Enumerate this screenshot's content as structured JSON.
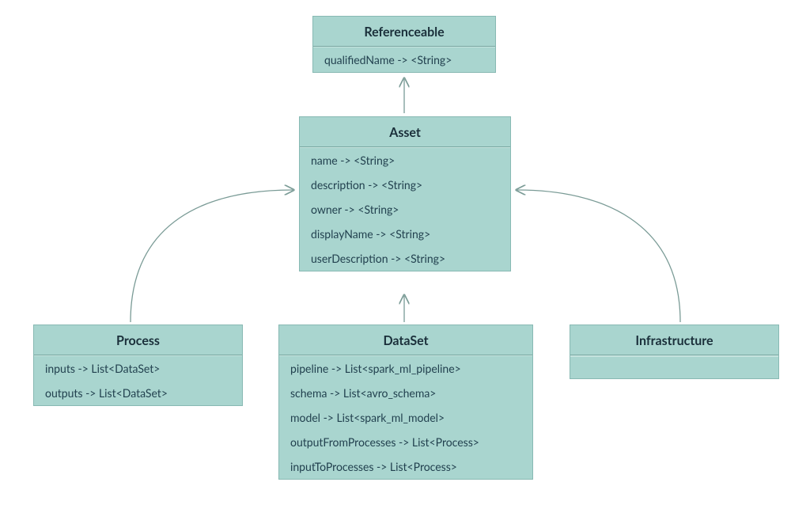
{
  "classes": {
    "referenceable": {
      "title": "Referenceable",
      "attrs": [
        "qualifiedName -> <String>"
      ]
    },
    "asset": {
      "title": "Asset",
      "attrs": [
        "name -> <String>",
        "description -> <String>",
        "owner -> <String>",
        "displayName -> <String>",
        "userDescription -> <String>"
      ]
    },
    "process": {
      "title": "Process",
      "attrs": [
        "inputs -> List<DataSet>",
        "outputs -> List<DataSet>"
      ]
    },
    "dataset": {
      "title": "DataSet",
      "attrs": [
        "pipeline -> List<spark_ml_pipeline>",
        "schema -> List<avro_schema>",
        "model -> List<spark_ml_model>",
        "outputFromProcesses -> List<Process>",
        "inputToProcesses -> List<Process>"
      ]
    },
    "infrastructure": {
      "title": "Infrastructure",
      "attrs": []
    }
  },
  "relationships": [
    {
      "from": "asset",
      "to": "referenceable",
      "type": "inherits"
    },
    {
      "from": "process",
      "to": "asset",
      "type": "inherits"
    },
    {
      "from": "dataset",
      "to": "asset",
      "type": "inherits"
    },
    {
      "from": "infrastructure",
      "to": "asset",
      "type": "inherits"
    }
  ],
  "colors": {
    "boxFill": "#a9d5cf",
    "boxBorder": "#88b9b3",
    "text": "#1e3a47",
    "arrow": "#7a9b96"
  }
}
